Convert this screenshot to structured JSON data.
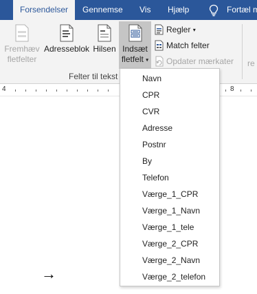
{
  "tabs": [
    {
      "label": "Forsendelser",
      "active": true
    },
    {
      "label": "Gennemse"
    },
    {
      "label": "Vis"
    },
    {
      "label": "Hjælp"
    },
    {
      "label": "Fortæl m"
    }
  ],
  "ribbon": {
    "fremhaev": {
      "line1": "Fremhæv",
      "line2": "fletfelter",
      "icon": "highlight-fields-icon"
    },
    "adresseblok": {
      "label": "Adresseblok",
      "icon": "address-block-icon"
    },
    "hilsen": {
      "label": "Hilsen",
      "icon": "greeting-line-icon"
    },
    "indsaet": {
      "line1": "Indsæt",
      "line2": "fletfelt",
      "caret": "▾",
      "icon": "insert-merge-field-icon"
    },
    "regler": {
      "label": "Regler",
      "caret": "▾",
      "icon": "rules-icon"
    },
    "match": {
      "label": "Match felter",
      "icon": "match-fields-icon"
    },
    "opdater": {
      "label": "Opdater mærkater",
      "icon": "update-labels-icon"
    },
    "group_label": "Felter til tekst",
    "truncated": "re"
  },
  "ruler": {
    "numbers": [
      "4",
      "8"
    ]
  },
  "document": {
    "arrow": "→"
  },
  "dropdown": {
    "items": [
      "Navn",
      "CPR",
      "CVR",
      "Adresse",
      "Postnr",
      "By",
      "Telefon",
      "Værge_1_CPR",
      "Værge_1_Navn",
      "Værge_1_tele",
      "Værge_2_CPR",
      "Værge_2_Navn",
      "Værge_2_telefon"
    ]
  },
  "colors": {
    "accent": "#2b579a",
    "ribbon_bg": "#f3f3f3",
    "selected_button": "#c5c5c5"
  }
}
